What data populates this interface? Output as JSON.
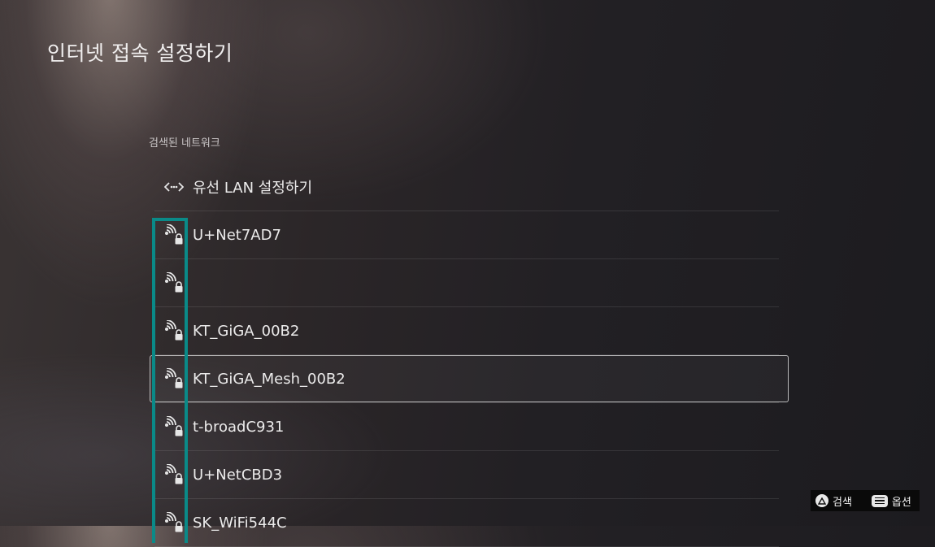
{
  "header": {
    "title": "인터넷 접속 설정하기"
  },
  "section": {
    "label": "검색된 네트워크"
  },
  "networks": [
    {
      "icon": "wired-lan-icon",
      "label": "유선 LAN 설정하기",
      "focused": false
    },
    {
      "icon": "wifi-lock-icon",
      "label": "U+Net7AD7",
      "focused": false
    },
    {
      "icon": "wifi-lock-icon",
      "label": "",
      "focused": false
    },
    {
      "icon": "wifi-lock-icon",
      "label": "KT_GiGA_00B2",
      "focused": false
    },
    {
      "icon": "wifi-lock-icon",
      "label": "KT_GiGA_Mesh_00B2",
      "focused": true
    },
    {
      "icon": "wifi-lock-icon",
      "label": "t-broadC931",
      "focused": false
    },
    {
      "icon": "wifi-lock-icon",
      "label": "U+NetCBD3",
      "focused": false
    },
    {
      "icon": "wifi-lock-icon",
      "label": "SK_WiFi544C",
      "focused": false
    }
  ],
  "legend": {
    "search_label": "검색",
    "options_label": "옵션",
    "search_icon": "triangle-button-icon",
    "options_icon": "options-button-icon"
  },
  "colors": {
    "highlight": "#0a8a88"
  }
}
